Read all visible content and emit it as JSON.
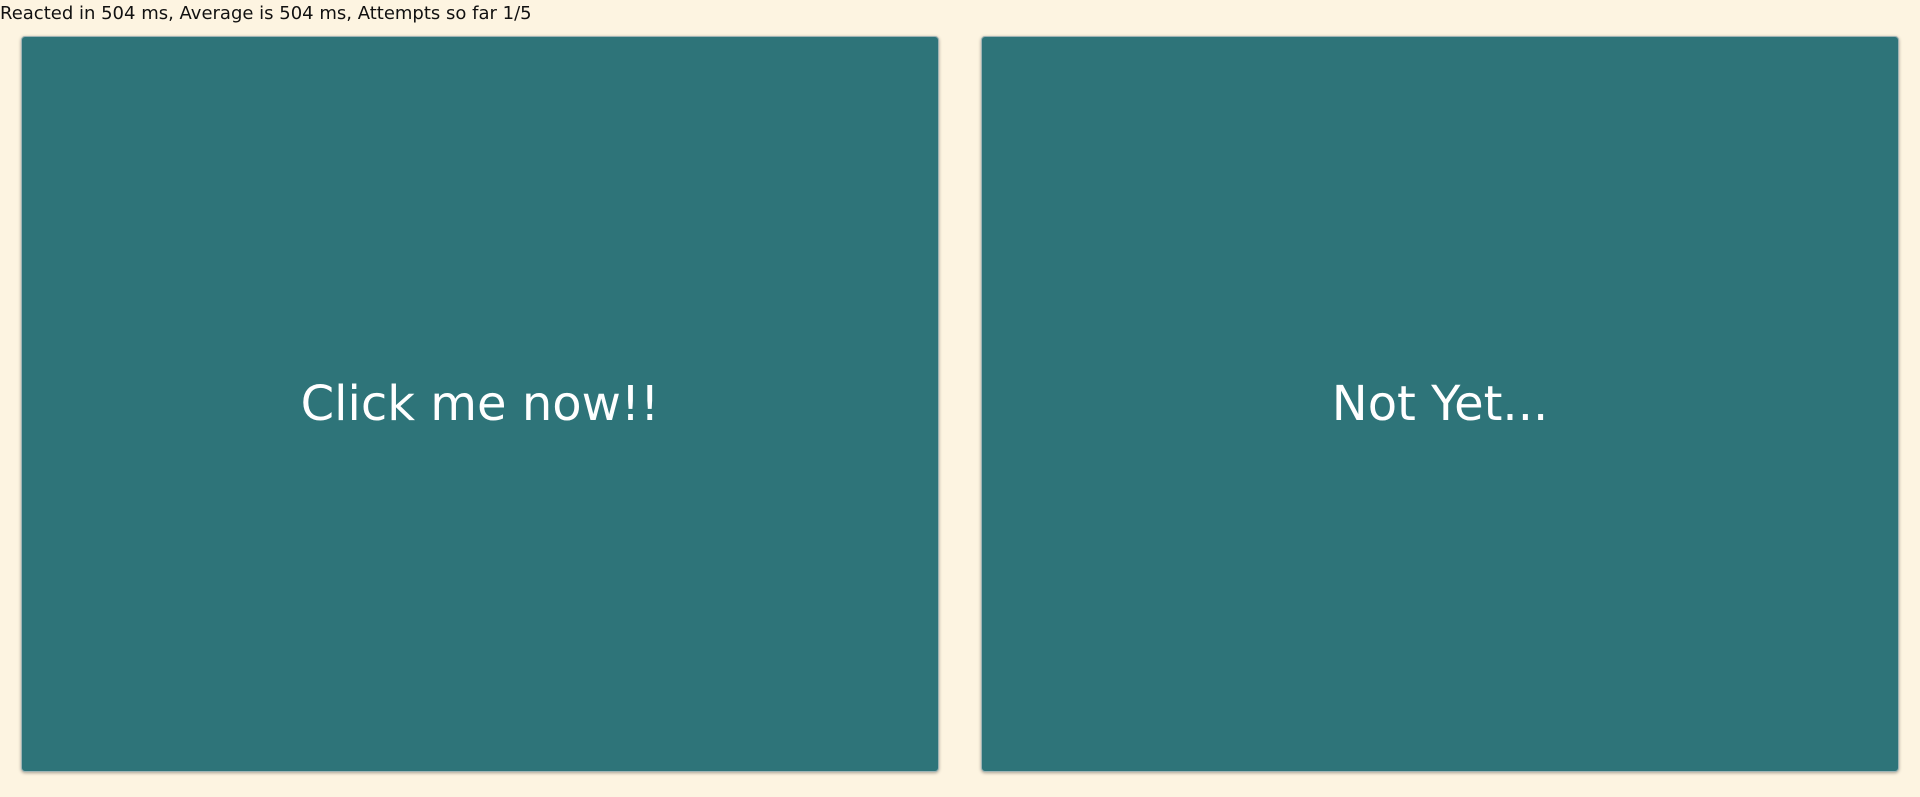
{
  "status": {
    "text": "Reacted in 504 ms, Average is 504 ms, Attempts so far 1/5"
  },
  "panels": [
    {
      "label": "Click me now!!"
    },
    {
      "label": "Not Yet..."
    }
  ],
  "colors": {
    "background": "#fdf4e1",
    "panel": "#2e7479",
    "panel_text": "#ffffff",
    "status_text": "#111111"
  }
}
